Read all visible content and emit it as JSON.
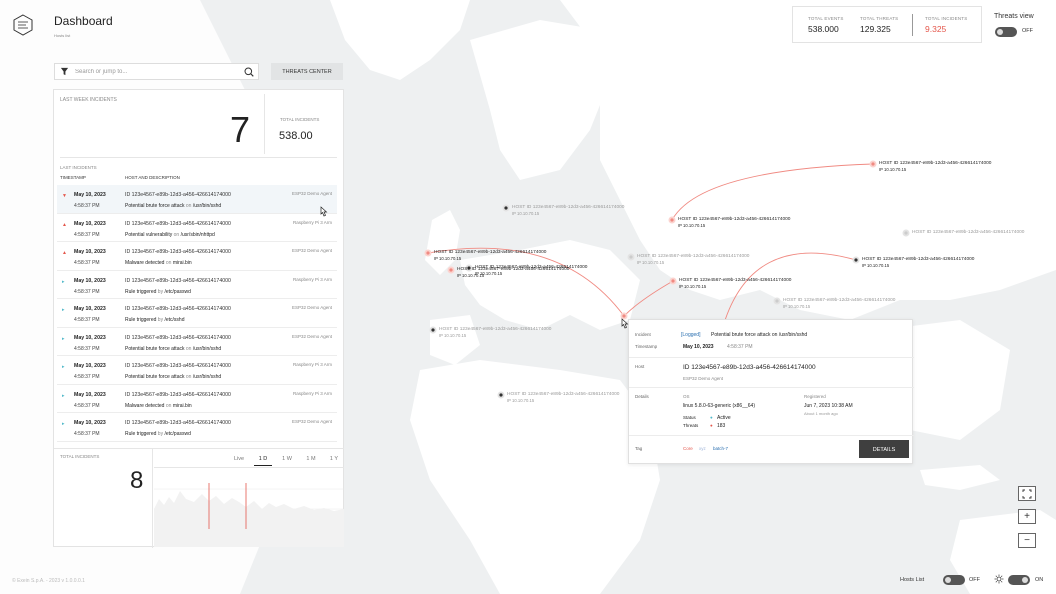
{
  "header": {
    "title": "Dashboard",
    "subtitle": "Hosts list"
  },
  "stats": {
    "total_events_label": "TOTAL EVENTS",
    "total_events": "538.000",
    "total_threats_label": "TOTAL THREATS",
    "total_threats": "129.325",
    "total_incidents_label": "TOTAL INCIDENTS",
    "total_incidents": "9.325",
    "incidents_color": "#e4574c"
  },
  "threats_view": {
    "label": "Threats view",
    "state": "OFF"
  },
  "search": {
    "placeholder": "Search or jump to..."
  },
  "threats_center_label": "THREATS CENTER",
  "panel": {
    "last_week_label": "LAST WEEK INCIDENTS",
    "last_week_value": "7",
    "total_incidents_label": "TOTAL INCIDENTS",
    "total_incidents_value": "538.00",
    "last_incidents_label": "LAST INCIDENTS",
    "col_timestamp": "TIMESTAMP",
    "col_host": "HOST AND DESCRIPTION",
    "rows": [
      {
        "date": "May 10, 2023",
        "time": "4:58:37 PM",
        "id": "ID 123e4567-e89b-12d3-a456-426614174000",
        "msg": "Potential brute force attack",
        "conn": "on",
        "target": "/usr/bin/sshd",
        "agent": "ESP32 Demo Agent",
        "level": "high"
      },
      {
        "date": "May 10, 2023",
        "time": "4:58:37 PM",
        "id": "ID 123e4567-e89b-12d3-a456-426614174000",
        "msg": "Potential vulnerability",
        "conn": "on",
        "target": "/usr/sbin/nhttpd",
        "agent": "Raspberry Pi 3 Arm",
        "level": "high"
      },
      {
        "date": "May 10, 2023",
        "time": "4:58:37 PM",
        "id": "ID 123e4567-e89b-12d3-a456-426614174000",
        "msg": "Malware detected",
        "conn": "on",
        "target": "mirai.bin",
        "agent": "ESP32 Demo Agent",
        "level": "high"
      },
      {
        "date": "May 10, 2023",
        "time": "4:58:37 PM",
        "id": "ID 123e4567-e89b-12d3-a456-426614174000",
        "msg": "Rule triggered",
        "conn": "by",
        "target": "/etc/passwd",
        "agent": "Raspberry Pi 3 Arm",
        "level": "low"
      },
      {
        "date": "May 10, 2023",
        "time": "4:58:37 PM",
        "id": "ID 123e4567-e89b-12d3-a456-426614174000",
        "msg": "Rule triggered",
        "conn": "by",
        "target": "/etc/sshd",
        "agent": "ESP32 Demo Agent",
        "level": "low"
      },
      {
        "date": "May 10, 2023",
        "time": "4:58:37 PM",
        "id": "ID 123e4567-e89b-12d3-a456-426614174000",
        "msg": "Potential brute force attack",
        "conn": "on",
        "target": "/usr/bin/sshd",
        "agent": "ESP32 Demo Agent",
        "level": "low"
      },
      {
        "date": "May 10, 2023",
        "time": "4:58:37 PM",
        "id": "ID 123e4567-e89b-12d3-a456-426614174000",
        "msg": "Potential brute force attack",
        "conn": "on",
        "target": "/usr/bin/sshd",
        "agent": "Raspberry Pi 3 Arm",
        "level": "low"
      },
      {
        "date": "May 10, 2023",
        "time": "4:58:37 PM",
        "id": "ID 123e4567-e89b-12d3-a456-426614174000",
        "msg": "Malware detected",
        "conn": "on",
        "target": "mirai.bin",
        "agent": "Raspberry Pi 3 Arm",
        "level": "low"
      },
      {
        "date": "May 10, 2023",
        "time": "4:58:37 PM",
        "id": "ID 123e4567-e89b-12d3-a456-426614174000",
        "msg": "Rule triggered",
        "conn": "by",
        "target": "/etc/passwd",
        "agent": "ESP32 Demo Agent",
        "level": "low"
      }
    ],
    "bottom_total_label": "TOTAL INCIDENTS",
    "bottom_total_value": "8",
    "tabs": [
      "Live",
      "1 D",
      "1 W",
      "1 M",
      "1 Y"
    ],
    "active_tab": "1 D"
  },
  "colors": {
    "high": "#e4574c",
    "low": "#4fb8c9",
    "accent": "#f08a82"
  },
  "hosts": [
    {
      "id": "HOST ID 123e4567-e89b-12d3-a456-426614174000",
      "ip": "IP    10.10.70.15",
      "style": "dark",
      "marker": "red"
    },
    {
      "id": "HOST ID 123e4567-e89b-12d3-a456-426614174000",
      "ip": "IP    10.10.70.15",
      "style": "dark",
      "marker": "red"
    },
    {
      "id": "HOST ID 123e4567-e89b-12d3-a456-426614174000",
      "ip": "IP    10.10.70.15",
      "style": "dark",
      "marker": "red"
    },
    {
      "id": "HOST ID 123e4567-e89b-12d3-a456-426614174000",
      "ip": "IP    10.10.70.15",
      "style": "dark",
      "marker": "red"
    },
    {
      "id": "HOST ID 123e4567-e89b-12d3-a456-426614174000",
      "ip": "IP    10.10.70.15",
      "style": "dark",
      "marker": "red"
    },
    {
      "id": "HOST ID 123e4567-e89b-12d3-a456-426614174000",
      "ip": "IP    10.10.70.15",
      "style": "dark",
      "marker": "black"
    },
    {
      "id": "HOST ID 123e4567-e89b-12d3-a456-426614174000",
      "ip": "IP    10.10.70.15",
      "style": "dark",
      "marker": "black"
    },
    {
      "id": "HOST ID 123e4567-e89b-12d3-a456-426614174000",
      "ip": "IP    10.10.70.15",
      "style": "light",
      "marker": "black"
    },
    {
      "id": "HOST ID 123e4567-e89b-12d3-a456-426614174000",
      "ip": "IP    10.10.70.15",
      "style": "light",
      "marker": "light"
    },
    {
      "id": "HOST ID 123e4567-e89b-12d3-a456-426614174000",
      "ip": "IP    10.10.70.15",
      "style": "light",
      "marker": "light"
    },
    {
      "id": "HOST ID 123e4567-e89b-12d3-a456-426614174000",
      "ip": "IP    10.10.70.15",
      "style": "light",
      "marker": "black"
    },
    {
      "id": "HOST ID 123e4567-e89b-12d3-a456-426614174000",
      "ip": "IP    10.10.70.15",
      "style": "light",
      "marker": "black"
    },
    {
      "id": "HOST ID 123e4567-e89b-12d3-a456-426614174000",
      "ip": "",
      "style": "light",
      "marker": "light"
    }
  ],
  "popup": {
    "incident_label": "Incident",
    "incident_tag": "[Logged]",
    "incident_value": "Potential brute force attack on /usr/bin/sshd",
    "timestamp_label": "Timestamp",
    "timestamp_date": "May 10, 2023",
    "timestamp_time": "4:58:37 PM",
    "host_label": "Host",
    "host_id": "ID 123e4567-e89b-12d3-a456-426614174000",
    "host_agent": "ESP32 Demo Agent",
    "details_label": "Details",
    "os_label": "OS",
    "os_value": "linux 5.8.0-63-generic (x86__64)",
    "registered_label": "Registered",
    "registered_value": "Jun 7, 2023 10:38 AM",
    "registered_ago": "About 1 month ago",
    "status_label": "Status",
    "status_value": "Active",
    "threats_label": "Threats",
    "threats_value": "183",
    "tag_label": "Tag",
    "tags": [
      "Core",
      "xyz",
      "batch-7"
    ],
    "details_button": "DETAILS"
  },
  "controls": {
    "fullscreen": "fullscreen-icon",
    "zoom_in": "+",
    "zoom_out": "−"
  },
  "hosts_list": {
    "label": "Hosts List",
    "state": "OFF"
  },
  "theme": {
    "state": "ON"
  },
  "footer": "© Exein S.p.A. - 2023 v 1.0.0.0.1"
}
